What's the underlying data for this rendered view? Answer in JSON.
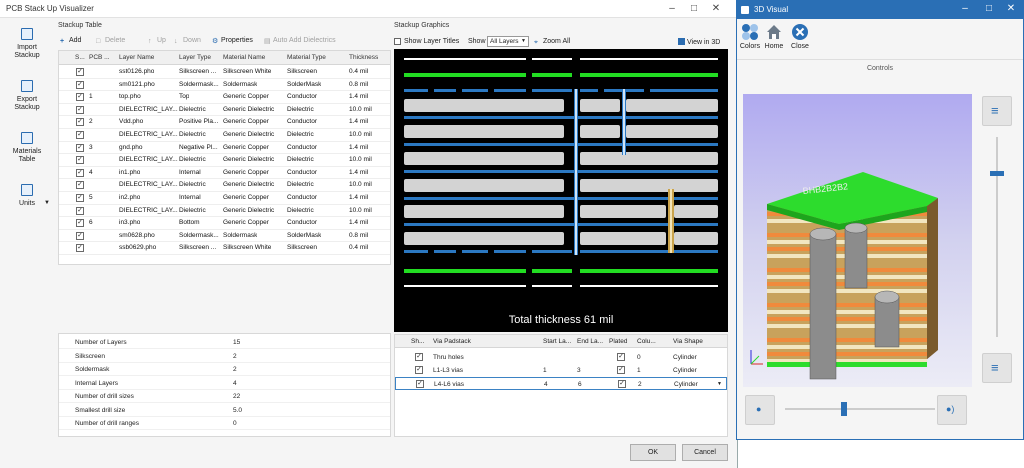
{
  "window": {
    "title": "PCB Stack Up Visualizer"
  },
  "leftnav": [
    {
      "label_l1": "Import",
      "label_l2": "Stackup"
    },
    {
      "label_l1": "Export",
      "label_l2": "Stackup"
    },
    {
      "label_l1": "Materials",
      "label_l2": "Table"
    },
    {
      "label_l1": "Units",
      "label_l2": ""
    }
  ],
  "stackup": {
    "title": "Stackup Table",
    "toolbar": {
      "add": "Add",
      "delete": "Delete",
      "up": "Up",
      "down": "Down",
      "properties": "Properties",
      "auto_add": "Auto Add Dielectrics"
    },
    "columns": [
      "S...",
      "PCB ...",
      "Layer Name",
      "Layer Type",
      "Material Name",
      "Material Type",
      "Thickness"
    ],
    "rows": [
      {
        "pcb": "",
        "name": "sst0126.pho",
        "type": "Silkscreen ...",
        "mat": "Silkscreen White",
        "mtype": "Silkscreen",
        "thk": "0.4 mil"
      },
      {
        "pcb": "",
        "name": "sm0121.pho",
        "type": "Soldermask...",
        "mat": "Soldermask",
        "mtype": "SolderMask",
        "thk": "0.8 mil"
      },
      {
        "pcb": "1",
        "name": "top.pho",
        "type": "Top",
        "mat": "Generic Copper",
        "mtype": "Conductor",
        "thk": "1.4 mil"
      },
      {
        "pcb": "",
        "name": "DIELECTRIC_LAY...",
        "type": "Dielectric",
        "mat": "Generic Dielectric",
        "mtype": "Dielectric",
        "thk": "10.0 mil"
      },
      {
        "pcb": "2",
        "name": "Vdd.pho",
        "type": "Positive Pla...",
        "mat": "Generic Copper",
        "mtype": "Conductor",
        "thk": "1.4 mil"
      },
      {
        "pcb": "",
        "name": "DIELECTRIC_LAY...",
        "type": "Dielectric",
        "mat": "Generic Dielectric",
        "mtype": "Dielectric",
        "thk": "10.0 mil"
      },
      {
        "pcb": "3",
        "name": "gnd.pho",
        "type": "Negative Pl...",
        "mat": "Generic Copper",
        "mtype": "Conductor",
        "thk": "1.4 mil"
      },
      {
        "pcb": "",
        "name": "DIELECTRIC_LAY...",
        "type": "Dielectric",
        "mat": "Generic Dielectric",
        "mtype": "Dielectric",
        "thk": "10.0 mil"
      },
      {
        "pcb": "4",
        "name": "in1.pho",
        "type": "Internal",
        "mat": "Generic Copper",
        "mtype": "Conductor",
        "thk": "1.4 mil"
      },
      {
        "pcb": "",
        "name": "DIELECTRIC_LAY...",
        "type": "Dielectric",
        "mat": "Generic Dielectric",
        "mtype": "Dielectric",
        "thk": "10.0 mil"
      },
      {
        "pcb": "5",
        "name": "in2.pho",
        "type": "Internal",
        "mat": "Generic Copper",
        "mtype": "Conductor",
        "thk": "1.4 mil"
      },
      {
        "pcb": "",
        "name": "DIELECTRIC_LAY...",
        "type": "Dielectric",
        "mat": "Generic Dielectric",
        "mtype": "Dielectric",
        "thk": "10.0 mil"
      },
      {
        "pcb": "6",
        "name": "in3.pho",
        "type": "Bottom",
        "mat": "Generic Copper",
        "mtype": "Conductor",
        "thk": "1.4 mil"
      },
      {
        "pcb": "",
        "name": "sm0628.pho",
        "type": "Soldermask...",
        "mat": "Soldermask",
        "mtype": "SolderMask",
        "thk": "0.8 mil"
      },
      {
        "pcb": "",
        "name": "ssb0629.pho",
        "type": "Silkscreen ...",
        "mat": "Silkscreen White",
        "mtype": "Silkscreen",
        "thk": "0.4 mil"
      }
    ]
  },
  "properties": [
    {
      "label": "Number of Layers",
      "value": "15"
    },
    {
      "label": "Silkscreen",
      "value": "2"
    },
    {
      "label": "Soldermask",
      "value": "2"
    },
    {
      "label": "Internal Layers",
      "value": "4"
    },
    {
      "label": "Number of drill sizes",
      "value": "22"
    },
    {
      "label": "Smallest drill size",
      "value": "5.0"
    },
    {
      "label": "Number of drill ranges",
      "value": "0"
    }
  ],
  "graphics": {
    "title": "Stackup Graphics",
    "show_layer_titles": "Show Layer Titles",
    "show_label": "Show",
    "show_value": "All Layers",
    "zoom_all": "Zoom All",
    "view_3d": "View in 3D",
    "total": "Total thickness 61 mil"
  },
  "vias": {
    "columns": [
      "Sh...",
      "Via Padstack",
      "Start La...",
      "End La...",
      "Plated",
      "Colu...",
      "Via Shape"
    ],
    "rows": [
      {
        "name": "Thru holes",
        "start": "",
        "end": "",
        "col": "0",
        "shape": "Cylinder"
      },
      {
        "name": "L1-L3 vias",
        "start": "1",
        "end": "3",
        "col": "1",
        "shape": "Cylinder"
      },
      {
        "name": "L4-L6 vias",
        "start": "4",
        "end": "6",
        "col": "2",
        "shape": "Cylinder"
      }
    ]
  },
  "buttons": {
    "ok": "OK",
    "cancel": "Cancel"
  },
  "visual3d": {
    "title": "3D Visual",
    "colors": "Colors",
    "home": "Home",
    "close": "Close",
    "controls": "Controls"
  },
  "colors": {
    "accent": "#2a6fb5",
    "copper_green": "#22dd22",
    "signal_blue": "#2b78c2"
  }
}
